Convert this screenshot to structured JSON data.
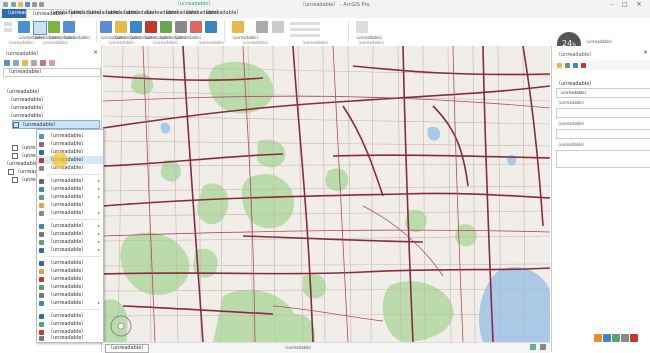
{
  "window": {
    "title": "〔unreadable〕 - ArcGIS Pro"
  },
  "quick_access": [
    "save-icon",
    "undo-icon",
    "redo-icon",
    "open-icon"
  ],
  "contextual_tab_header": "〔unreadable〕",
  "ribbon_tabs": [
    {
      "label": "〔unreadable〕",
      "name": "tab-file"
    },
    {
      "label": "〔unreadable〕",
      "name": "tab-map"
    },
    {
      "label": "〔unreadable〕",
      "name": "tab-insert"
    },
    {
      "label": "〔unreadable〕",
      "name": "tab-analysis"
    },
    {
      "label": "〔unreadable〕",
      "name": "tab-view"
    },
    {
      "label": "〔unreadable〕",
      "name": "tab-edit"
    },
    {
      "label": "〔unreadable〕",
      "name": "tab-imagery"
    },
    {
      "label": "〔unreadable〕",
      "name": "tab-share"
    },
    {
      "label": "〔unreadable〕",
      "name": "tab-feature-layer"
    },
    {
      "label": "〔unreadable〕",
      "name": "tab-labeling"
    },
    {
      "label": "〔unreadable〕",
      "name": "tab-data"
    }
  ],
  "ribbon": {
    "groups": [
      "〔unreadable〕",
      "〔unreadable〕",
      "〔unreadable〕",
      "〔unreadable〕",
      "〔unreadable〕",
      "〔unreadable〕",
      "〔unreadable〕",
      "〔unreadable〕"
    ],
    "buttons": [
      "〔unreadable〕",
      "〔unreadable〕",
      "〔unreadable〕",
      "〔unreadable〕",
      "〔unreadable〕",
      "〔unreadable〕",
      "〔unreadable〕",
      "〔unreadable〕",
      "〔unreadable〕",
      "〔unreadable〕",
      "〔unreadable〕",
      "〔unreadable〕"
    ]
  },
  "clock": {
    "value": "24",
    "unit": "%"
  },
  "account": "〔unreadable〕",
  "contents": {
    "title": "〔unreadable〕",
    "search_value": "〔unreadable〕",
    "tree": [
      {
        "label": "〔unreadable〕",
        "indent": 0,
        "checked": false
      },
      {
        "label": "〔unreadable〕",
        "indent": 1,
        "checked": false
      },
      {
        "label": "〔unreadable〕",
        "indent": 1,
        "checked": true
      },
      {
        "label": "〔unreadable〕",
        "indent": 1,
        "checked": true
      },
      {
        "label": "〔unreadable〕",
        "indent": 2,
        "checked": true,
        "selected": true
      },
      {
        "label": "〔unreadable〕",
        "indent": 2,
        "checked": true
      },
      {
        "label": "〔unreadable〕",
        "indent": 2,
        "checked": true
      },
      {
        "label": "〔unreadable〕",
        "indent": 1,
        "checked": true
      },
      {
        "label": "〔unreadable〕",
        "indent": 1,
        "checked": true
      },
      {
        "label": "〔unreadable〕",
        "indent": 2,
        "checked": true
      }
    ]
  },
  "context_menu": {
    "items": [
      {
        "label": "〔unreadable〕",
        "icon_color": "#4a90d9"
      },
      {
        "label": "〔unreadable〕",
        "icon_color": "#777"
      },
      {
        "label": "〔unreadable〕",
        "icon_color": "#2b6cb0"
      },
      {
        "label": "〔unreadable〕",
        "icon_color": "#c0392b",
        "highlight": true
      },
      {
        "label": "〔unreadable〕",
        "icon_color": "#888"
      },
      {
        "sep": true
      },
      {
        "label": "〔unreadable〕",
        "icon_color": "#666",
        "submenu": true
      },
      {
        "label": "〔unreadable〕",
        "icon_color": "#3a86c8",
        "submenu": true
      },
      {
        "label": "〔unreadable〕",
        "icon_color": "#5aa469",
        "submenu": true
      },
      {
        "label": "〔unreadable〕",
        "icon_color": "#e6a23c"
      },
      {
        "label": "〔unreadable〕",
        "icon_color": "#888",
        "submenu": true
      },
      {
        "sep": true
      },
      {
        "label": "〔unreadable〕",
        "icon_color": "#3a86c8",
        "submenu": true
      },
      {
        "label": "〔unreadable〕",
        "icon_color": "#777",
        "submenu": true
      },
      {
        "label": "〔unreadable〕",
        "icon_color": "#5aa469",
        "submenu": true
      },
      {
        "label": "〔unreadable〕",
        "icon_color": "#2b6cb0",
        "submenu": true
      },
      {
        "sep": true
      },
      {
        "label": "〔unreadable〕",
        "icon_color": "#2b6cb0"
      },
      {
        "label": "〔unreadable〕",
        "icon_color": "#e6a23c"
      },
      {
        "label": "〔unreadable〕",
        "icon_color": "#c0392b"
      },
      {
        "label": "〔unreadable〕",
        "icon_color": "#5aa469"
      },
      {
        "label": "〔unreadable〕",
        "icon_color": "#777"
      },
      {
        "label": "〔unreadable〕",
        "icon_color": "#3a86c8",
        "submenu": true
      },
      {
        "sep": true
      },
      {
        "label": "〔unreadable〕",
        "icon_color": "#2b6cb0"
      },
      {
        "label": "〔unreadable〕",
        "icon_color": "#5aa469"
      },
      {
        "label": "〔unreadable〕",
        "icon_color": "#c0392b"
      },
      {
        "label": "〔unreadable〕",
        "icon_color": "#777"
      }
    ]
  },
  "status": {
    "scale": "〔unreadable〕",
    "coordinates": "〔unreadable〕"
  },
  "right_pane": {
    "title": "〔unreadable〕",
    "section": "〔unreadable〕",
    "name_value": "〔unreadable〕",
    "field_labels": [
      "〔unreadable〕",
      "〔unreadable〕",
      "〔unreadable〕"
    ]
  },
  "colors": {
    "accent": "#2b6cb0",
    "map_bg": "#f1eee9",
    "road": "#7a2038",
    "green": "#b5d8a7",
    "water": "#a9c9e6"
  }
}
